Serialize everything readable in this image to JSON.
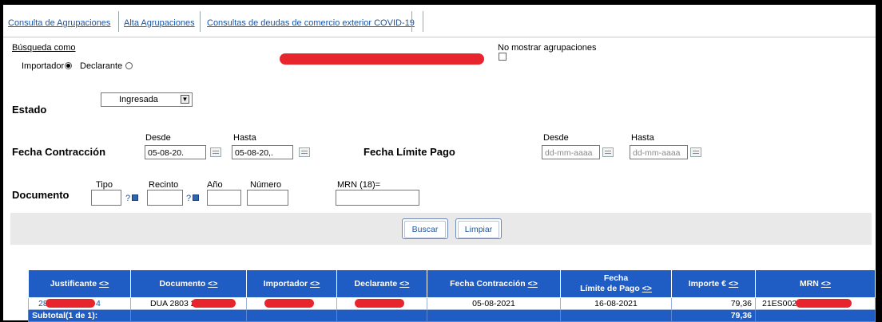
{
  "tabs": [
    "Consulta de Agrupaciones",
    "Alta Agrupaciones",
    "Consultas de deudas de comercio exterior COVID-19"
  ],
  "search": {
    "busqueda_label": "Búsqueda como",
    "importador_label": "Importador",
    "declarante_label": "Declarante",
    "no_mostrar_label": "No mostrar agrupaciones"
  },
  "estado": {
    "label": "Estado",
    "value": "Ingresada"
  },
  "fecha_contraccion": {
    "label": "Fecha Contracción",
    "desde_label": "Desde",
    "desde_value": "05-08-20.",
    "hasta_label": "Hasta",
    "hasta_value": "05-08-20,."
  },
  "fecha_limite": {
    "label": "Fecha Límite Pago",
    "desde_label": "Desde",
    "desde_placeholder": "dd-mm-aaaa",
    "hasta_label": "Hasta",
    "hasta_placeholder": "dd-mm-aaaa"
  },
  "documento": {
    "label": "Documento",
    "tipo_label": "Tipo",
    "recinto_label": "Recinto",
    "anio_label": "Año",
    "numero_label": "Número",
    "mrn_label": "MRN (18)=",
    "help_mark": "?"
  },
  "buttons": {
    "buscar": "Buscar",
    "limpiar": "Limpiar"
  },
  "table": {
    "headers": [
      "Justificante",
      "Documento",
      "Importador",
      "Declarante",
      "Fecha Contracción",
      "Fecha\nLímite de Pago",
      "Importe €",
      "MRN"
    ],
    "sort_glyph": "<>",
    "row": {
      "justificante": "28",
      "justificante_end": "4",
      "documento": "DUA 2803 2",
      "fecha_contraccion": "05-08-2021",
      "fecha_limite": "16-08-2021",
      "importe": "79,36",
      "mrn": "21ES002"
    },
    "subtotal_label": "Subtotal(1 de 1):",
    "subtotal_importe": "79,36"
  }
}
